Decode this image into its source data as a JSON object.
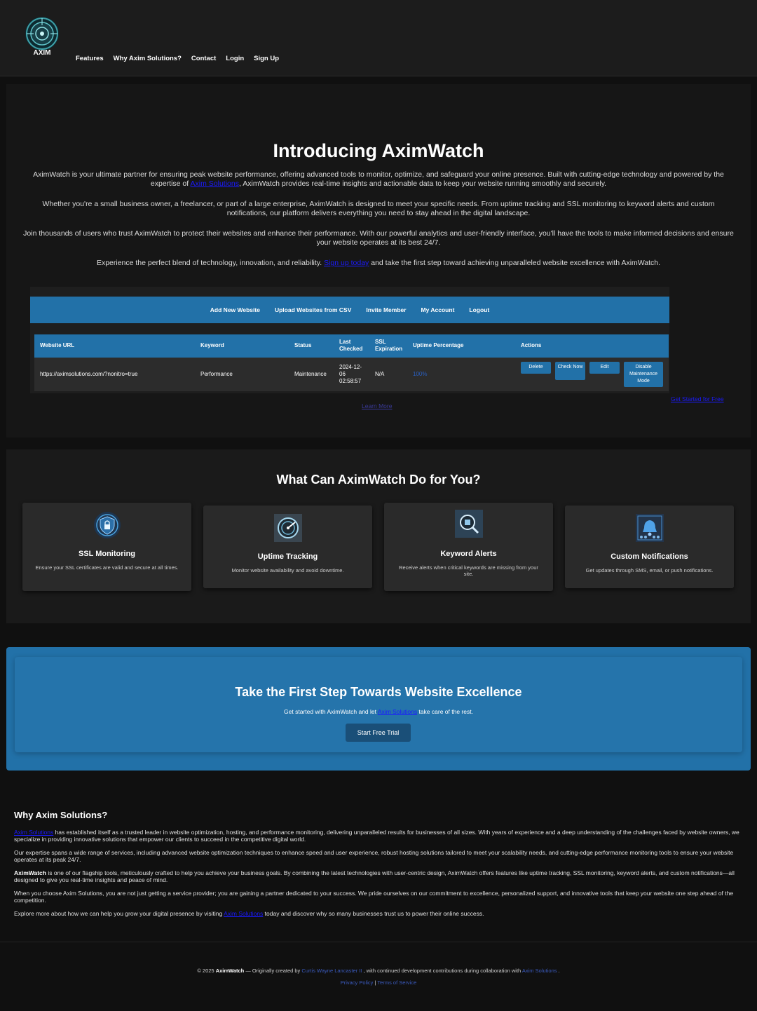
{
  "header": {
    "logo_text": "AXIM",
    "nav": [
      "Features",
      "Why Axim Solutions?",
      "Contact",
      "Login",
      "Sign Up"
    ]
  },
  "hero": {
    "title": "Introducing AximWatch",
    "p1_before": "AximWatch is your ultimate partner for ensuring peak website performance, offering advanced tools to monitor, optimize, and safeguard your online presence. Built with cutting-edge technology and powered by the expertise of ",
    "p1_link": "Axim Solutions",
    "p1_after": ", AximWatch provides real-time insights and actionable data to keep your website running smoothly and securely.",
    "p2": "Whether you're a small business owner, a freelancer, or part of a large enterprise, AximWatch is designed to meet your specific needs. From uptime tracking and SSL monitoring to keyword alerts and custom notifications, our platform delivers everything you need to stay ahead in the digital landscape.",
    "p3": "Join thousands of users who trust AximWatch to protect their websites and enhance their performance. With our powerful analytics and user-friendly interface, you'll have the tools to make informed decisions and ensure your website operates at its best 24/7.",
    "p4_before": "Experience the perfect blend of technology, innovation, and reliability. ",
    "p4_link": "Sign up today",
    "p4_after": " and take the first step toward achieving unparalleled website excellence with AximWatch.",
    "get_started_link": "Get Started for Free",
    "learn_more_link": "Learn More"
  },
  "dashboard_preview": {
    "menu": [
      "Add New Website",
      "Upload Websites from CSV",
      "Invite Member",
      "My Account",
      "Logout"
    ],
    "columns": [
      "Website URL",
      "Keyword",
      "Status",
      "Last Checked",
      "SSL Expiration",
      "Uptime Percentage",
      "Actions"
    ],
    "row": {
      "url": "https://aximsolutions.com/?nonitro=true",
      "keyword": "Performance",
      "status": "Maintenance",
      "last_checked": "2024-12-06 02:58:57",
      "ssl": "N/A",
      "uptime": "100%"
    },
    "actions": [
      "Delete",
      "Check Now",
      "Edit",
      "Disable Maintenance Mode"
    ]
  },
  "features": {
    "title": "What Can AximWatch Do for You?",
    "cards": [
      {
        "icon": "shield-lock-icon",
        "title": "SSL Monitoring",
        "desc": "Ensure your SSL certificates are valid and secure at all times."
      },
      {
        "icon": "gauge-icon",
        "title": "Uptime Tracking",
        "desc": "Monitor website availability and avoid downtime."
      },
      {
        "icon": "magnifier-alert-icon",
        "title": "Keyword Alerts",
        "desc": "Receive alerts when critical keywords are missing from your site."
      },
      {
        "icon": "bell-icon",
        "title": "Custom Notifications",
        "desc": "Get updates through SMS, email, or push notifications."
      }
    ]
  },
  "cta": {
    "title": "Take the First Step Towards Website Excellence",
    "text_before": "Get started with AximWatch and let ",
    "text_link": "Axim Solutions",
    "text_after": " take care of the rest.",
    "button": "Start Free Trial"
  },
  "about": {
    "title": "Why Axim Solutions?",
    "p1_link": "Axim Solutions",
    "p1": " has established itself as a trusted leader in website optimization, hosting, and performance monitoring, delivering unparalleled results for businesses of all sizes. With years of experience and a deep understanding of the challenges faced by website owners, we specialize in providing innovative solutions that empower our clients to succeed in the competitive digital world.",
    "p2": "Our expertise spans a wide range of services, including advanced website optimization techniques to enhance speed and user experience, robust hosting solutions tailored to meet your scalability needs, and cutting-edge performance monitoring tools to ensure your website operates at its peak 24/7.",
    "p3_bold": "AximWatch",
    "p3": " is one of our flagship tools, meticulously crafted to help you achieve your business goals. By combining the latest technologies with user-centric design, AximWatch offers features like uptime tracking, SSL monitoring, keyword alerts, and custom notifications—all designed to give you real-time insights and peace of mind.",
    "p4": "When you choose Axim Solutions, you are not just getting a service provider; you are gaining a partner dedicated to your success. We pride ourselves on our commitment to excellence, personalized support, and innovative tools that keep your website one step ahead of the competition.",
    "p5_before": "Explore more about how we can help you grow your digital presence by visiting ",
    "p5_link": "Axim Solutions",
    "p5_after": " today and discover why so many businesses trust us to power their online success."
  },
  "footer": {
    "copyright": "© 2025 ",
    "brand": "AximWatch",
    "mid": " — Originally created by ",
    "creator": "Curtis Wayne Lancaster II",
    "mid2": " , with continued development contributions during collaboration with ",
    "partner": "Axim Solutions",
    "end": " .",
    "privacy": "Privacy Policy",
    "sep": "|",
    "terms": "Terms of Service"
  },
  "colors": {
    "accent": "#2271a8",
    "background": "#101010",
    "link": "#1a1aff"
  }
}
